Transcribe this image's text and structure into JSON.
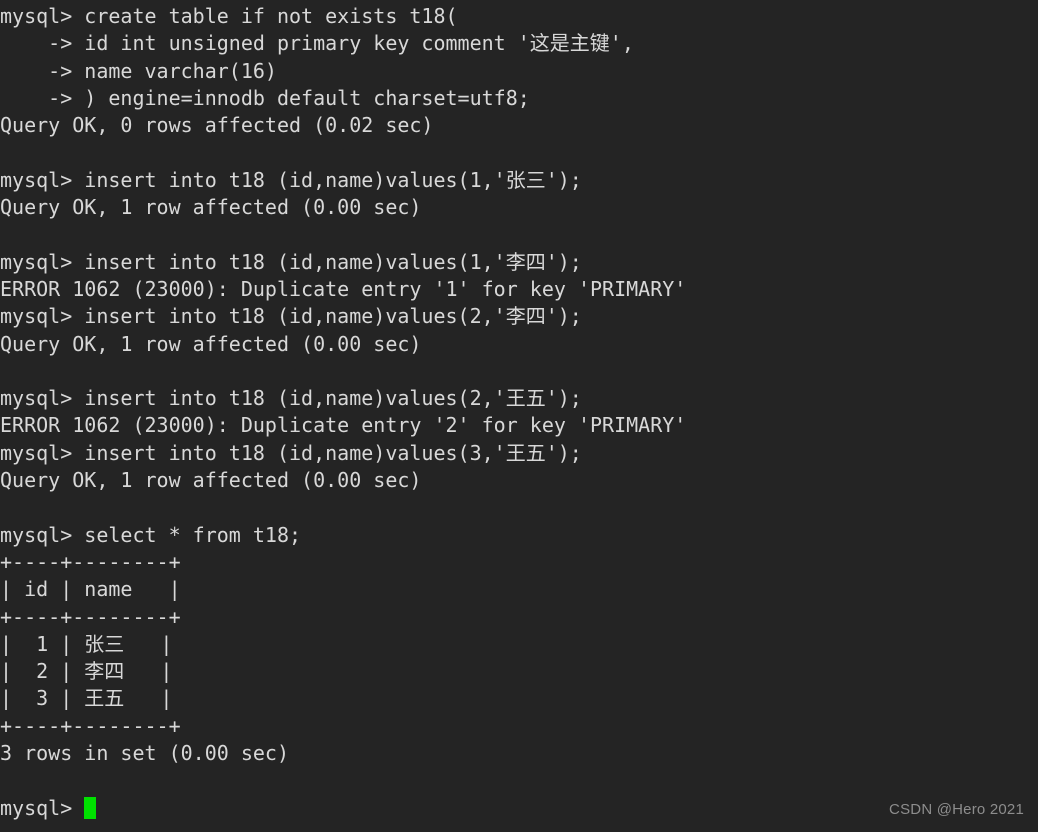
{
  "terminal": {
    "background_color": "#242424",
    "foreground_color": "#d8d8d8",
    "cursor_color": "#00e000",
    "prompt": "mysql> ",
    "continuation_prompt": "    -> ",
    "lines": [
      "mysql> create table if not exists t18(",
      "    -> id int unsigned primary key comment '这是主键',",
      "    -> name varchar(16)",
      "    -> ) engine=innodb default charset=utf8;",
      "Query OK, 0 rows affected (0.02 sec)",
      "",
      "mysql> insert into t18 (id,name)values(1,'张三');",
      "Query OK, 1 row affected (0.00 sec)",
      "",
      "mysql> insert into t18 (id,name)values(1,'李四');",
      "ERROR 1062 (23000): Duplicate entry '1' for key 'PRIMARY'",
      "mysql> insert into t18 (id,name)values(2,'李四');",
      "Query OK, 1 row affected (0.00 sec)",
      "",
      "mysql> insert into t18 (id,name)values(2,'王五');",
      "ERROR 1062 (23000): Duplicate entry '2' for key 'PRIMARY'",
      "mysql> insert into t18 (id,name)values(3,'王五');",
      "Query OK, 1 row affected (0.00 sec)",
      "",
      "mysql> select * from t18;",
      "+----+--------+",
      "| id | name   |",
      "+----+--------+",
      "|  1 | 张三   |",
      "|  2 | 李四   |",
      "|  3 | 王五   |",
      "+----+--------+",
      "3 rows in set (0.00 sec)",
      ""
    ],
    "final_prompt": "mysql> ",
    "result_table": {
      "columns": [
        "id",
        "name"
      ],
      "rows": [
        [
          "1",
          "张三"
        ],
        [
          "2",
          "李四"
        ],
        [
          "3",
          "王五"
        ]
      ],
      "row_count_text": "3 rows in set (0.00 sec)"
    },
    "statements": [
      "create table if not exists t18( id int unsigned primary key comment '这是主键', name varchar(16) ) engine=innodb default charset=utf8;",
      "insert into t18 (id,name)values(1,'张三');",
      "insert into t18 (id,name)values(1,'李四');",
      "insert into t18 (id,name)values(2,'李四');",
      "insert into t18 (id,name)values(2,'王五');",
      "insert into t18 (id,name)values(3,'王五');",
      "select * from t18;"
    ],
    "errors": [
      "ERROR 1062 (23000): Duplicate entry '1' for key 'PRIMARY'",
      "ERROR 1062 (23000): Duplicate entry '2' for key 'PRIMARY'"
    ]
  },
  "watermark": {
    "text": "CSDN @Hero 2021"
  }
}
